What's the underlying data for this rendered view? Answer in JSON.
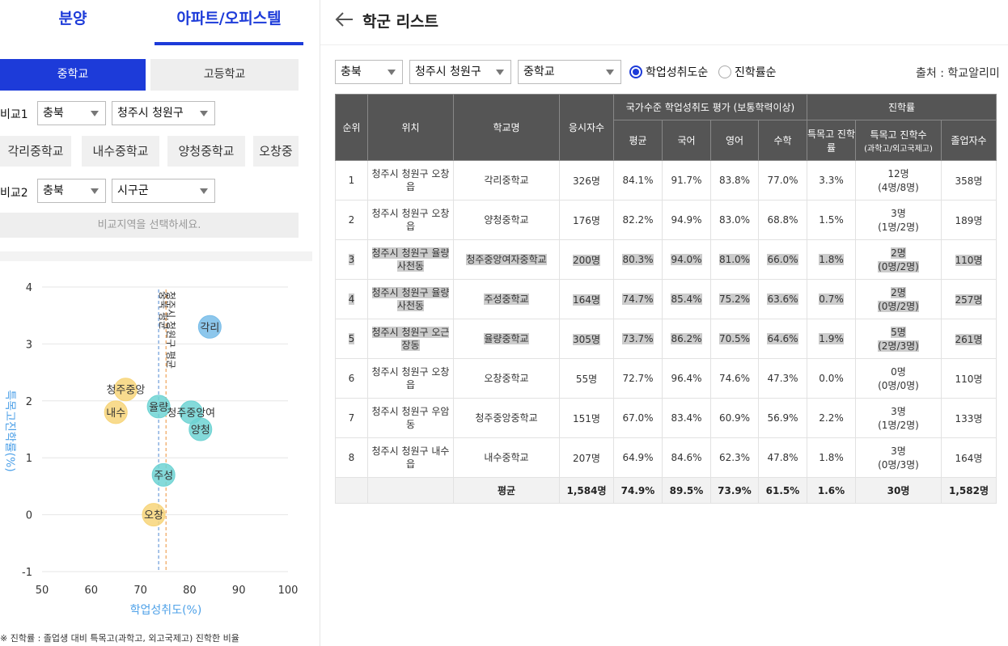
{
  "tabs": {
    "sale": "분양",
    "apt": "아파트/오피스텔"
  },
  "school_type": {
    "middle": "중학교",
    "high": "고등학교"
  },
  "compare1": {
    "label": "비교1",
    "province": "충북",
    "district": "청주시 청원구"
  },
  "school_chips": [
    "각리중학교",
    "내수중학교",
    "양청중학교",
    "오창중"
  ],
  "compare2": {
    "label": "비교2",
    "province": "충북",
    "district": "시구군"
  },
  "compare_notice": "비교지역을 선택하세요.",
  "footnote": "※ 진학률 : 졸업생 대비 특목고(과학고, 외고국제고) 진학한 비율",
  "page_title": "학군 리스트",
  "filters": {
    "province": "충북",
    "district": "청주시 청원구",
    "level": "중학교"
  },
  "sort_options": [
    "학업성취도순",
    "진학률순"
  ],
  "source": "출처 : 학교알리미",
  "colors": {
    "accent": "#1d3bd9",
    "header": "#555555",
    "yellow": "#f7d57a",
    "teal": "#6fd3d3",
    "blue": "#79bde9"
  },
  "table": {
    "header_group_achievement": "국가수준 학업성취도 평가 (보통학력이상)",
    "header_group_advance": "진학률",
    "headers": {
      "rank": "순위",
      "location": "위치",
      "school": "학교명",
      "examinees": "응시자수",
      "avg": "평균",
      "korean": "국어",
      "english": "영어",
      "math": "수학",
      "special_rate": "특목고 진학률",
      "special_count": "특목고 진학수",
      "special_count_sub": "(과학고/외고국제고)",
      "graduates": "졸업자수"
    },
    "rows": [
      {
        "rank": "1",
        "location": "청주시 청원구 오창읍",
        "school": "각리중학교",
        "examinees": "326명",
        "avg": "84.1%",
        "korean": "91.7%",
        "english": "83.8%",
        "math": "77.0%",
        "rate": "3.3%",
        "count": "12명",
        "count_detail": "(4명/8명)",
        "grads": "358명",
        "highlight": false
      },
      {
        "rank": "2",
        "location": "청주시 청원구 오창읍",
        "school": "양청중학교",
        "examinees": "176명",
        "avg": "82.2%",
        "korean": "94.9%",
        "english": "83.0%",
        "math": "68.8%",
        "rate": "1.5%",
        "count": "3명",
        "count_detail": "(1명/2명)",
        "grads": "189명",
        "highlight": false
      },
      {
        "rank": "3",
        "location": "청주시 청원구 율량사천동",
        "school": "청주중앙여자중학교",
        "examinees": "200명",
        "avg": "80.3%",
        "korean": "94.0%",
        "english": "81.0%",
        "math": "66.0%",
        "rate": "1.8%",
        "count": "2명",
        "count_detail": "(0명/2명)",
        "grads": "110명",
        "highlight": true
      },
      {
        "rank": "4",
        "location": "청주시 청원구 율량사천동",
        "school": "주성중학교",
        "examinees": "164명",
        "avg": "74.7%",
        "korean": "85.4%",
        "english": "75.2%",
        "math": "63.6%",
        "rate": "0.7%",
        "count": "2명",
        "count_detail": "(0명/2명)",
        "grads": "257명",
        "highlight": true
      },
      {
        "rank": "5",
        "location": "청주시 청원구 오근장동",
        "school": "율량중학교",
        "examinees": "305명",
        "avg": "73.7%",
        "korean": "86.2%",
        "english": "70.5%",
        "math": "64.6%",
        "rate": "1.9%",
        "count": "5명",
        "count_detail": "(2명/3명)",
        "grads": "261명",
        "highlight": true
      },
      {
        "rank": "6",
        "location": "청주시 청원구 오창읍",
        "school": "오창중학교",
        "examinees": "55명",
        "avg": "72.7%",
        "korean": "96.4%",
        "english": "74.6%",
        "math": "47.3%",
        "rate": "0.0%",
        "count": "0명",
        "count_detail": "(0명/0명)",
        "grads": "110명",
        "highlight": false
      },
      {
        "rank": "7",
        "location": "청주시 청원구 우암동",
        "school": "청주중앙중학교",
        "examinees": "151명",
        "avg": "67.0%",
        "korean": "83.4%",
        "english": "60.9%",
        "math": "56.9%",
        "rate": "2.2%",
        "count": "3명",
        "count_detail": "(1명/2명)",
        "grads": "133명",
        "highlight": false
      },
      {
        "rank": "8",
        "location": "청주시 청원구 내수읍",
        "school": "내수중학교",
        "examinees": "207명",
        "avg": "64.9%",
        "korean": "84.6%",
        "english": "62.3%",
        "math": "47.8%",
        "rate": "1.8%",
        "count": "3명",
        "count_detail": "(0명/3명)",
        "grads": "164명",
        "highlight": false
      }
    ],
    "average": {
      "label": "평균",
      "examinees": "1,584명",
      "avg": "74.9%",
      "korean": "89.5%",
      "english": "73.9%",
      "math": "61.5%",
      "rate": "1.6%",
      "count": "30명",
      "grads": "1,582명"
    }
  },
  "chart_data": {
    "type": "scatter",
    "xlabel": "학업성취도(%)",
    "ylabel": "특목고진학률(%)",
    "xlim": [
      50,
      100
    ],
    "ylim": [
      -1,
      4
    ],
    "xticks": [
      50,
      60,
      70,
      80,
      90,
      100
    ],
    "yticks": [
      -1,
      0,
      1,
      2,
      3,
      4
    ],
    "points": [
      {
        "label": "각리",
        "x": 84.1,
        "y": 3.3,
        "color": "#79bde9"
      },
      {
        "label": "양청",
        "x": 82.2,
        "y": 1.5,
        "color": "#6fd3d3"
      },
      {
        "label": "청주중앙여",
        "x": 80.3,
        "y": 1.8,
        "color": "#6fd3d3"
      },
      {
        "label": "주성",
        "x": 74.7,
        "y": 0.7,
        "color": "#6fd3d3"
      },
      {
        "label": "율량",
        "x": 73.7,
        "y": 1.9,
        "color": "#6fd3d3"
      },
      {
        "label": "오창",
        "x": 72.7,
        "y": 0.0,
        "color": "#f7d57a"
      },
      {
        "label": "청주중앙",
        "x": 67.0,
        "y": 2.2,
        "color": "#f7d57a"
      },
      {
        "label": "내수",
        "x": 65.0,
        "y": 1.8,
        "color": "#f7d57a"
      }
    ],
    "ref_lines": [
      {
        "label": "충북 평균",
        "x": 73.7,
        "color": "#6c9bd8"
      },
      {
        "label": "청주시 청원구 평균",
        "x": 75.2,
        "color": "#f0a45a"
      }
    ]
  }
}
